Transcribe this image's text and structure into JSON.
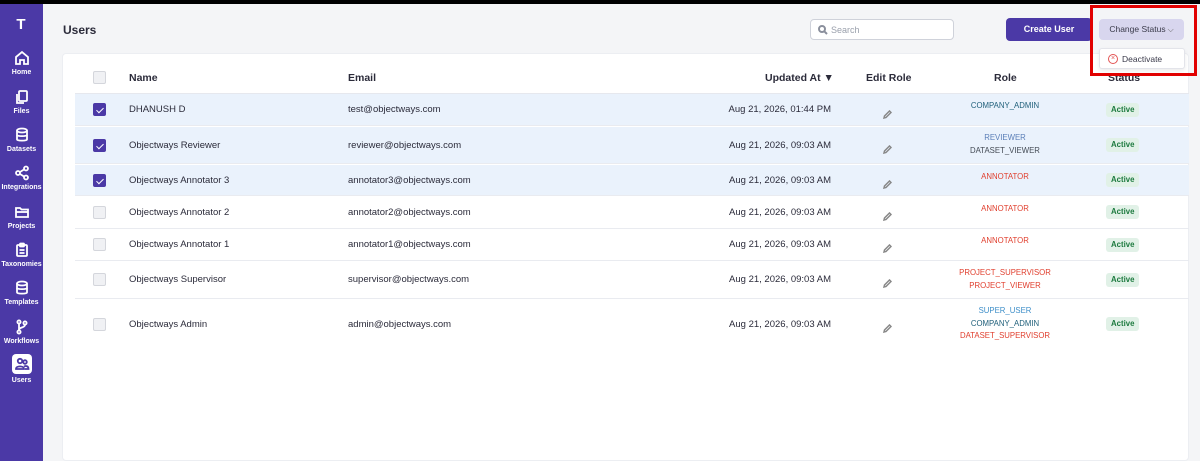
{
  "sidebar": {
    "logo": "T",
    "items": [
      {
        "label": "Home"
      },
      {
        "label": "Files"
      },
      {
        "label": "Datasets"
      },
      {
        "label": "Integrations"
      },
      {
        "label": "Projects"
      },
      {
        "label": "Taxonomies"
      },
      {
        "label": "Templates"
      },
      {
        "label": "Workflows"
      },
      {
        "label": "Users",
        "active": true
      }
    ]
  },
  "header": {
    "title": "Users",
    "search_placeholder": "Search",
    "create_label": "Create User",
    "change_status_label": "Change Status",
    "change_status_chevron": "⌵"
  },
  "dropdown": {
    "icon": "x-circle-icon",
    "item_label": "Deactivate"
  },
  "table": {
    "columns": {
      "name": "Name",
      "email": "Email",
      "updated": "Updated At",
      "sort_icon": "▼",
      "edit": "Edit Role",
      "role": "Role",
      "status": "Status"
    },
    "rows": [
      {
        "selected": true,
        "name": "DHANUSH D",
        "email": "test@objectways.com",
        "updated": "Aug 21, 2026, 01:44 PM",
        "roles": [
          {
            "text": "COMPANY_ADMIN",
            "color": "#1f5f7a"
          }
        ],
        "status": "Active"
      },
      {
        "selected": true,
        "name": "Objectways Reviewer",
        "email": "reviewer@objectways.com",
        "updated": "Aug 21, 2026, 09:03 AM",
        "roles": [
          {
            "text": "REVIEWER",
            "color": "#5b7fb8"
          },
          {
            "text": "DATASET_VIEWER",
            "color": "#444b55"
          }
        ],
        "status": "Active"
      },
      {
        "selected": true,
        "name": "Objectways Annotator 3",
        "email": "annotator3@objectways.com",
        "updated": "Aug 21, 2026, 09:03 AM",
        "roles": [
          {
            "text": "ANNOTATOR",
            "color": "#e03e2d"
          }
        ],
        "status": "Active"
      },
      {
        "selected": false,
        "name": "Objectways Annotator 2",
        "email": "annotator2@objectways.com",
        "updated": "Aug 21, 2026, 09:03 AM",
        "roles": [
          {
            "text": "ANNOTATOR",
            "color": "#e03e2d"
          }
        ],
        "status": "Active"
      },
      {
        "selected": false,
        "name": "Objectways Annotator 1",
        "email": "annotator1@objectways.com",
        "updated": "Aug 21, 2026, 09:03 AM",
        "roles": [
          {
            "text": "ANNOTATOR",
            "color": "#e03e2d"
          }
        ],
        "status": "Active"
      },
      {
        "selected": false,
        "name": "Objectways Supervisor",
        "email": "supervisor@objectways.com",
        "updated": "Aug 21, 2026, 09:03 AM",
        "roles": [
          {
            "text": "PROJECT_SUPERVISOR",
            "color": "#e03e2d"
          },
          {
            "text": "PROJECT_VIEWER",
            "color": "#e03e2d"
          }
        ],
        "status": "Active"
      },
      {
        "selected": false,
        "name": "Objectways Admin",
        "email": "admin@objectways.com",
        "updated": "Aug 21, 2026, 09:03 AM",
        "roles": [
          {
            "text": "SUPER_USER",
            "color": "#3f8fc9"
          },
          {
            "text": "COMPANY_ADMIN",
            "color": "#1f5f7a"
          },
          {
            "text": "DATASET_SUPERVISOR",
            "color": "#e03e2d"
          }
        ],
        "status": "Active"
      }
    ]
  },
  "colors": {
    "brand": "#4b39a6",
    "highlight": "#e10000",
    "active_badge_bg": "#e1f1e7",
    "active_badge_text": "#1c7a3e"
  }
}
